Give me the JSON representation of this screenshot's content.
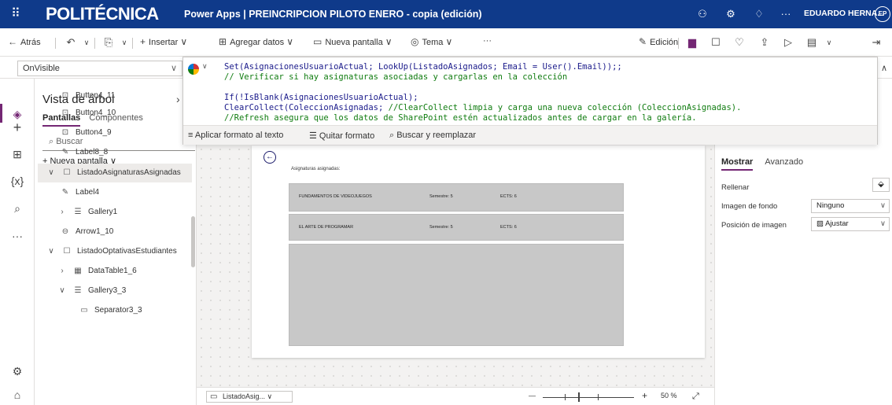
{
  "topbar": {
    "brand": "POLITÉCNICA",
    "title": "Power Apps | PREINCRIPCION PILOTO ENERO - copia (edición)",
    "user": "EDUARDO HERNA...",
    "avatar": "EP"
  },
  "commandbar": {
    "back": "Atrás",
    "insert": "Insertar",
    "add_data": "Agregar datos",
    "new_screen": "Nueva pantalla",
    "theme": "Tema",
    "more": "···",
    "edit": "Edición"
  },
  "formula": {
    "property": "OnVisible",
    "fx": "fx",
    "lines": [
      {
        "code": "Set(AsignacionesUsuarioActual; LookUp(ListadoAsignados; Email = User().Email));;",
        "comment": ""
      },
      {
        "code": "",
        "comment": "// Verificar si hay asignaturas asociadas y cargarlas en la colección"
      },
      {
        "code": "",
        "comment": ""
      },
      {
        "code": "If(!IsBlank(AsignacionesUsuarioActual);",
        "comment": ""
      },
      {
        "code": "ClearCollect(ColeccionAsignadas; ",
        "comment": "//ClearCollect limpia y carga una nueva colección (ColeccionAsignadas)."
      },
      {
        "code": "",
        "comment": "//Refresh asegura que los datos de SharePoint estén actualizados antes de cargar en la galería."
      }
    ],
    "format": "Aplicar formato al texto",
    "remove_format": "Quitar formato",
    "find_replace": "Buscar y reemplazar"
  },
  "tree": {
    "title": "Vista de árbol",
    "tab_screens": "Pantallas",
    "tab_components": "Componentes",
    "search_placeholder": "Buscar",
    "new_screen": "Nueva pantalla",
    "items": [
      {
        "label": "Button4_11",
        "icon": "button-icon"
      },
      {
        "label": "Button4_10",
        "icon": "button-icon"
      },
      {
        "label": "Button4_9",
        "icon": "button-icon"
      },
      {
        "label": "Label8_8",
        "icon": "label-icon"
      },
      {
        "label": "ListadoAsignaturasAsignadas",
        "icon": "container-icon"
      },
      {
        "label": "Label4",
        "icon": "label-icon"
      },
      {
        "label": "Gallery1",
        "icon": "gallery-icon"
      },
      {
        "label": "Arrow1_10",
        "icon": "arrow-icon"
      },
      {
        "label": "ListadoOptativasEstudiantes",
        "icon": "container-icon"
      },
      {
        "label": "DataTable1_6",
        "icon": "table-icon"
      },
      {
        "label": "Gallery3_3",
        "icon": "gallery-icon"
      },
      {
        "label": "Separator3_3",
        "icon": "separator-icon"
      }
    ]
  },
  "canvas": {
    "heading": "Asignaturas asignadas:",
    "rows": [
      {
        "name": "FUNDAMENTOS DE VIDEOJUEGOS",
        "semester": "Semestre: 5",
        "ects": "ECTS: 6"
      },
      {
        "name": "EL ARTE DE PROGRAMAR",
        "semester": "Semestre: 5",
        "ects": "ECTS: 6"
      }
    ],
    "screen_select": "ListadoAsig...",
    "zoom": "50 %"
  },
  "props": {
    "tab_show": "Mostrar",
    "tab_advanced": "Avanzado",
    "fill": "Rellenar",
    "bg_image": "Imagen de fondo",
    "bg_image_value": "Ninguno",
    "image_position": "Posición de imagen",
    "image_position_value": "Ajustar"
  }
}
